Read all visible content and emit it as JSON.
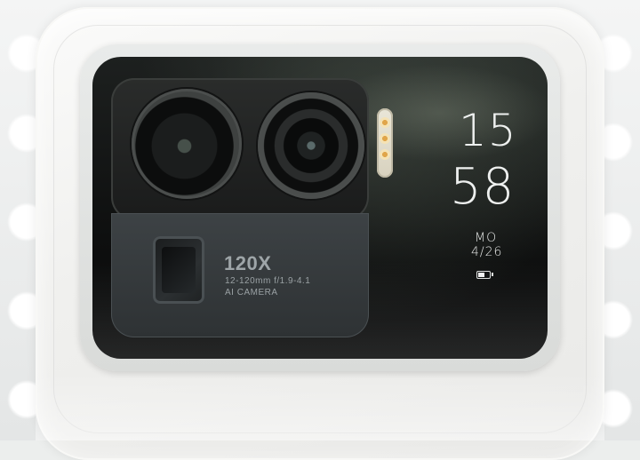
{
  "camera_module": {
    "zoom_text": "120X",
    "spec_text": "12-120mm f/1.9-4.1",
    "ai_text": "AI CAMERA"
  },
  "secondary_display": {
    "hour": "15",
    "minute": "58",
    "weekday": "MO",
    "date": "4/26",
    "battery_level_percent": 60
  },
  "colors": {
    "phone_body": "#f0f0ee",
    "display_text": "#eef0ef",
    "flash_led": "#e0a54a"
  },
  "icons": [
    "battery-icon",
    "flash-icon",
    "periscope-lens-icon",
    "main-lens-icon",
    "ultrawide-lens-icon"
  ]
}
